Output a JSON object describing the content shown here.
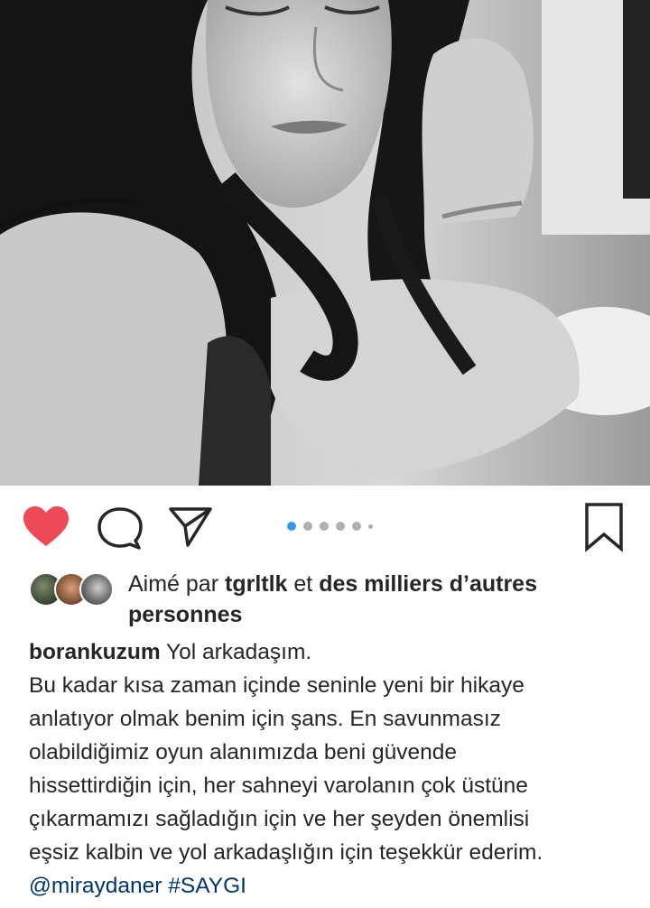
{
  "post": {
    "photo_icon": "black-and-white-portrait-photo",
    "actions": {
      "like_icon": "heart-filled-icon",
      "comment_icon": "comment-bubble-icon",
      "share_icon": "paper-plane-icon",
      "save_icon": "bookmark-icon",
      "like_color": "#ed4956"
    },
    "carousel": {
      "total_dots": 6,
      "active_index": 0,
      "active_color": "#3897f0"
    },
    "likes": {
      "prefix": "Aimé par",
      "user": "tgrltlk",
      "middle": "et",
      "rest_line1": "des milliers d’autres",
      "rest_line2": "personnes"
    },
    "caption": {
      "username": "borankuzum",
      "first_line": "Yol arkadaşım.",
      "lines": [
        "Bu kadar kısa zaman içinde seninle yeni bir hikaye",
        "anlatıyor olmak benim için şans. En savunmasız",
        "olabildiğimiz oyun alanımızda beni güvende",
        "hissettirdiğin için, her sahneyi varolanın çok üstüne",
        "çıkarmamızı sağladığın için ve her şeyden önemlisi",
        "eşsiz kalbin ve yol arkadaşlığın için teşekkür ederim."
      ],
      "mention": "@miraydaner",
      "hashtag": "#SAYGI"
    }
  }
}
